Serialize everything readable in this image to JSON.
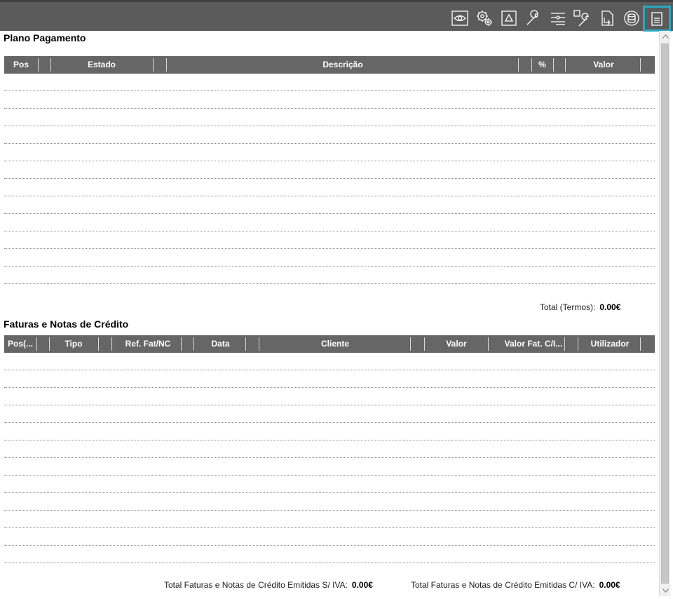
{
  "toolbar": {
    "icons": [
      "eye-icon",
      "gears-icon",
      "triangle-icon",
      "wrench-icon",
      "list-settings-icon",
      "shape-wrench-icon",
      "document-arrow-icon",
      "database-icon",
      "document-lines-icon"
    ],
    "active_index": 8,
    "background": "#5b5b5b",
    "active_color": "#2aa7c2"
  },
  "plano": {
    "title": "Plano Pagamento",
    "columns": [
      "Pos",
      "Estado",
      "Descrição",
      "%",
      "Valor"
    ],
    "rows": [
      [],
      [],
      [],
      [],
      [],
      [],
      [],
      [],
      [],
      [],
      [],
      []
    ],
    "total_label": "Total (Termos):",
    "total_value": "0.00€"
  },
  "faturas": {
    "title": "Faturas e Notas de Crédito",
    "columns": [
      "Pos(...",
      "Tipo",
      "Ref. Fat/NC",
      "Data",
      "Cliente",
      "Valor",
      "Valor Fat. C/I...",
      "Utilizador"
    ],
    "rows": [
      [],
      [],
      [],
      [],
      [],
      [],
      [],
      [],
      [],
      [],
      [],
      []
    ],
    "total_siva_label": "Total Faturas e Notas de Crédito Emitidas S/ IVA:",
    "total_siva_value": "0.00€",
    "total_civa_label": "Total Faturas e Notas de Crédito Emitidas C/ IVA:",
    "total_civa_value": "0.00€"
  },
  "colors": {
    "header_bg": "#666666",
    "header_text": "#ffffff"
  }
}
